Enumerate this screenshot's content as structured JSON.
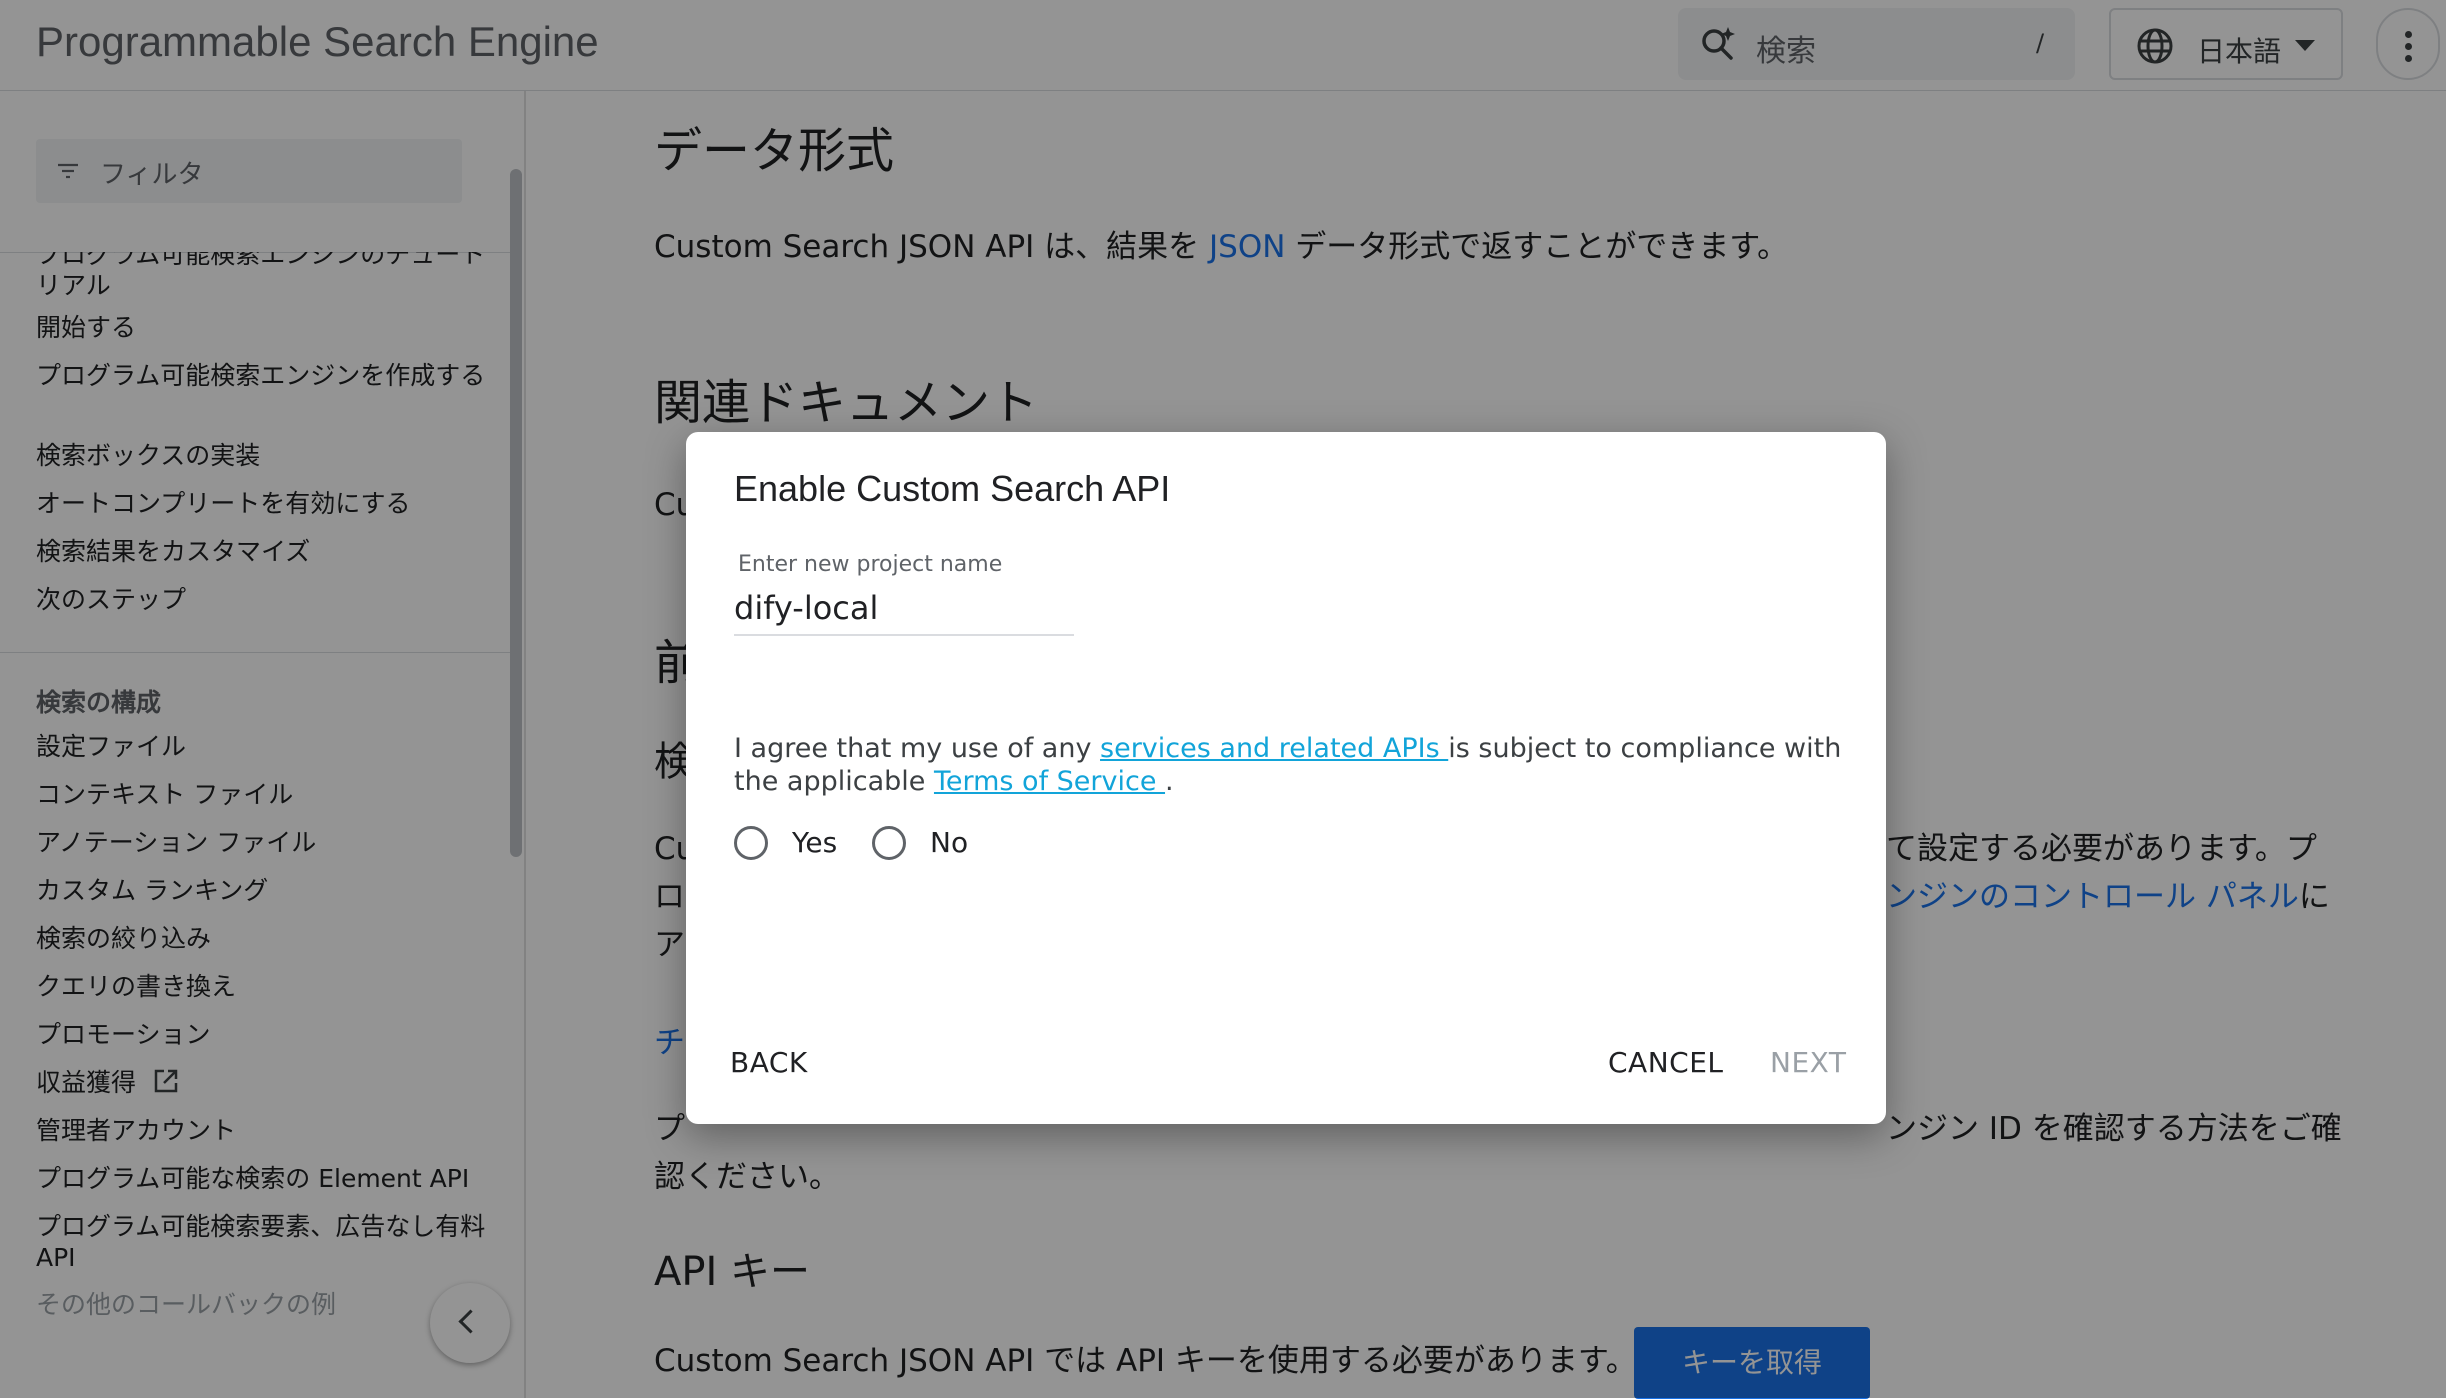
{
  "header": {
    "brand": "Programmable Search Engine",
    "search_placeholder": "検索",
    "search_shortcut": "/",
    "language": "日本語"
  },
  "sidebar": {
    "filter_placeholder": "フィルタ",
    "items_top": [
      "プログラム可能検索エンジンのチュートリアル",
      "開始する",
      "プログラム可能検索エンジンを作成する",
      "検索ボックスの実装",
      "オートコンプリートを有効にする",
      "検索結果をカスタマイズ",
      "次のステップ"
    ],
    "section_heading": "検索の構成",
    "items_bottom": [
      "設定ファイル",
      "コンテキスト ファイル",
      "アノテーション ファイル",
      "カスタム ランキング",
      "検索の絞り込み",
      "クエリの書き換え",
      "プロモーション",
      "収益獲得",
      "管理者アカウント",
      "プログラム可能な検索の Element API",
      "プログラム可能検索要素、広告なし有料 API",
      "その他のコールバックの例"
    ]
  },
  "main": {
    "heading_data_format": "データ形式",
    "data_format_text_1": "Custom Search JSON API は、結果を ",
    "data_format_link": "JSON",
    "data_format_text_2": " データ形式で返すことができます。",
    "heading_related": "関連ドキュメント",
    "related_fragment": "Cu",
    "heading_prereq_fragment": "前",
    "subheading_fragment": "検",
    "para1_line1_left": "Cu",
    "para1_line1_right": "て設定する必要があります。プ",
    "para1_line2_left": "ロ",
    "para1_line2_link": "ンジンのコントロール パネル",
    "para1_line2_right": "に",
    "para1_line3_left": "ア",
    "link_fragment": "チ",
    "para2_line1_left": "プ",
    "para2_line1_right": "ンジン ID を確認する方法をご確",
    "para2_line2": "認ください。",
    "heading_api_key": "API キー",
    "api_key_text": "Custom Search JSON API では API キーを使用する必要があります。",
    "api_key_button": "キーを取得"
  },
  "dialog": {
    "title": "Enable Custom Search API",
    "field_label": "Enter new project name",
    "field_value": "dify-local",
    "agree_text_1": "I agree that my use of any ",
    "agree_link_1": "services and related APIs ",
    "agree_text_2": "is subject to compliance with the applicable ",
    "agree_link_2": "Terms of Service ",
    "agree_text_3": ".",
    "radio_yes": "Yes",
    "radio_no": "No",
    "back_button": "BACK",
    "cancel_button": "CANCEL",
    "next_button": "NEXT"
  },
  "colors": {
    "accent": "#1a73e8",
    "dialog_link": "#12a4d9",
    "disabled_text": "#9aa0a6"
  }
}
